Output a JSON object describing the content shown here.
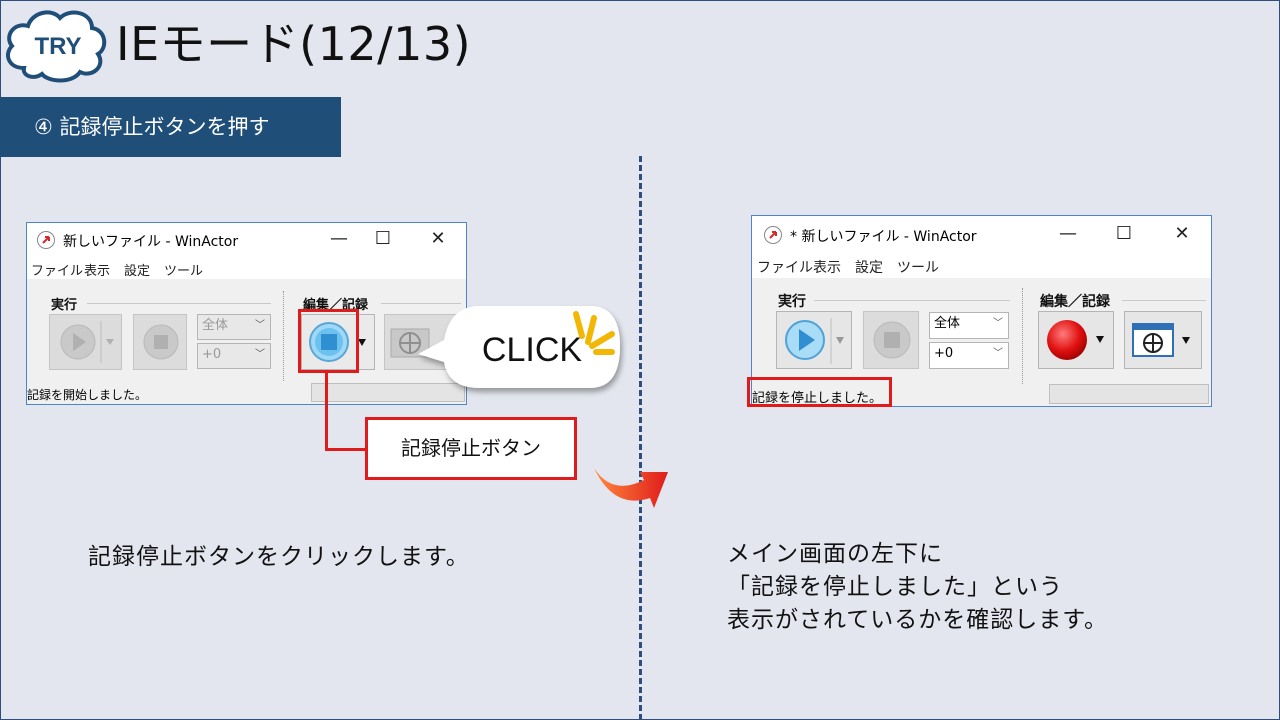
{
  "header": {
    "badge": "TRY",
    "title": "IEモード(12/13)",
    "step": "④ 記録停止ボタンを押す"
  },
  "colors": {
    "banner": "#1f4e79",
    "highlight": "#e01b1b",
    "background": "#e3e6ee",
    "divider": "#2e4f7c"
  },
  "left_window": {
    "title": "新しいファイル - WinActor",
    "controls": [
      "—",
      "☐",
      "✕"
    ],
    "menu": [
      "ファイル",
      "表示",
      "設定",
      "ツール"
    ],
    "group_run": "実行",
    "group_edit": "編集／記録",
    "scope_select": "全体",
    "offset_select": "+0",
    "status": "記録を開始しました。"
  },
  "right_window": {
    "title": "* 新しいファイル - WinActor",
    "controls": [
      "—",
      "☐",
      "✕"
    ],
    "menu": [
      "ファイル",
      "表示",
      "設定",
      "ツール"
    ],
    "group_run": "実行",
    "group_edit": "編集／記録",
    "scope_select": "全体",
    "offset_select": "+0",
    "status": "記録を停止しました。"
  },
  "click_bubble": "CLICK",
  "callout": "記録停止ボタン",
  "left_description": "記録停止ボタンをクリックします。",
  "right_description": [
    "メイン画面の左下に",
    "「記録を停止しました」という",
    "表示がされているかを確認します。"
  ]
}
